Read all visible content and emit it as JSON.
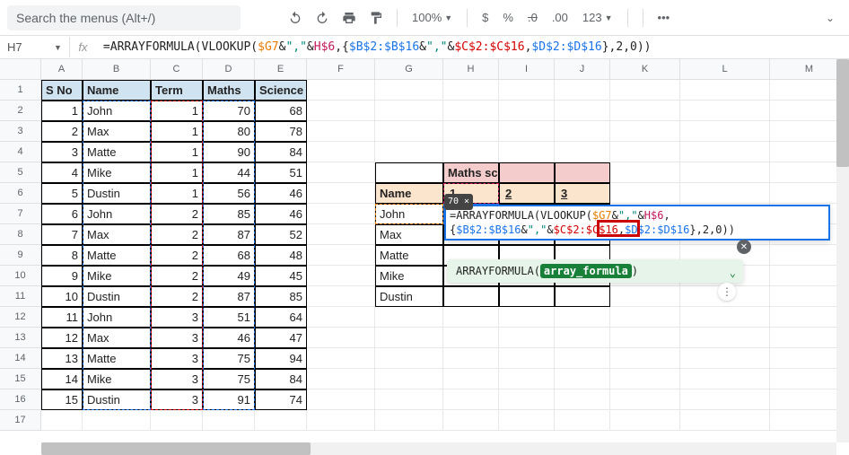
{
  "toolbar": {
    "search_placeholder": "Search the menus (Alt+/)",
    "zoom": "100%",
    "currency": "$",
    "percent": "%",
    "dec_dec": ".0",
    "inc_dec": ".00",
    "fmt": "123",
    "more": "•••"
  },
  "formulaBar": {
    "cellRef": "H7",
    "fx": "fx",
    "segments": [
      {
        "t": "=",
        "c": "eq"
      },
      {
        "t": "ARRAYFORMULA",
        "c": "fc-fn"
      },
      {
        "t": "(",
        "c": "fc-plain"
      },
      {
        "t": "VLOOKUP",
        "c": "fc-fn"
      },
      {
        "t": "(",
        "c": "fc-plain"
      },
      {
        "t": "$G7",
        "c": "fc-orange"
      },
      {
        "t": "&",
        "c": "fc-plain"
      },
      {
        "t": "\",\"",
        "c": "fc-teal"
      },
      {
        "t": "&",
        "c": "fc-plain"
      },
      {
        "t": "H$6",
        "c": "fc-mag"
      },
      {
        "t": ",{",
        "c": "fc-plain"
      },
      {
        "t": "$B$2:$B$16",
        "c": "fc-blue"
      },
      {
        "t": "&",
        "c": "fc-plain"
      },
      {
        "t": "\",\"",
        "c": "fc-teal"
      },
      {
        "t": "&",
        "c": "fc-plain"
      },
      {
        "t": "$C$2:$C$16",
        "c": "fc-red"
      },
      {
        "t": ",",
        "c": "fc-plain"
      },
      {
        "t": "$D$2:$D$16",
        "c": "fc-blue"
      },
      {
        "t": "},",
        "c": "fc-plain"
      },
      {
        "t": "2",
        "c": "fc-plain"
      },
      {
        "t": ",",
        "c": "fc-plain"
      },
      {
        "t": "0",
        "c": "fc-plain"
      },
      {
        "t": "))",
        "c": "fc-plain"
      }
    ]
  },
  "cols": [
    "A",
    "B",
    "C",
    "D",
    "E",
    "F",
    "G",
    "H",
    "I",
    "J",
    "K",
    "L",
    "M"
  ],
  "rows": [
    "1",
    "2",
    "3",
    "4",
    "5",
    "6",
    "7",
    "8",
    "9",
    "10",
    "11",
    "12",
    "13",
    "14",
    "15",
    "16",
    "17"
  ],
  "mainHeaders": {
    "a": "S No",
    "b": "Name",
    "c": "Term",
    "d": "Maths",
    "e": "Science"
  },
  "mainData": [
    {
      "sno": "1",
      "name": "John",
      "term": "1",
      "m": "70",
      "s": "68"
    },
    {
      "sno": "2",
      "name": "Max",
      "term": "1",
      "m": "80",
      "s": "78"
    },
    {
      "sno": "3",
      "name": "Matte",
      "term": "1",
      "m": "90",
      "s": "84"
    },
    {
      "sno": "4",
      "name": "Mike",
      "term": "1",
      "m": "44",
      "s": "51"
    },
    {
      "sno": "5",
      "name": "Dustin",
      "term": "1",
      "m": "56",
      "s": "46"
    },
    {
      "sno": "6",
      "name": "John",
      "term": "2",
      "m": "85",
      "s": "46"
    },
    {
      "sno": "7",
      "name": "Max",
      "term": "2",
      "m": "87",
      "s": "52"
    },
    {
      "sno": "8",
      "name": "Matte",
      "term": "2",
      "m": "68",
      "s": "48"
    },
    {
      "sno": "9",
      "name": "Mike",
      "term": "2",
      "m": "49",
      "s": "45"
    },
    {
      "sno": "10",
      "name": "Dustin",
      "term": "2",
      "m": "87",
      "s": "85"
    },
    {
      "sno": "11",
      "name": "John",
      "term": "3",
      "m": "51",
      "s": "64"
    },
    {
      "sno": "12",
      "name": "Max",
      "term": "3",
      "m": "46",
      "s": "47"
    },
    {
      "sno": "13",
      "name": "Matte",
      "term": "3",
      "m": "75",
      "s": "94"
    },
    {
      "sno": "14",
      "name": "Mike",
      "term": "3",
      "m": "75",
      "s": "84"
    },
    {
      "sno": "15",
      "name": "Dustin",
      "term": "3",
      "m": "91",
      "s": "74"
    }
  ],
  "side": {
    "title": "Maths scores",
    "nameHdr": "Name",
    "cols": [
      "1",
      "2",
      "3"
    ],
    "names": [
      "John",
      "Max",
      "Matte",
      "Mike",
      "Dustin"
    ]
  },
  "fedit": {
    "result": "70 ×",
    "line1a": "=ARRAYFORMULA(VLOOKUP(",
    "line1_g7": "$G7",
    "line1b": "&",
    "line1_q1": "\",\"",
    "line1c": "&",
    "line1_h6": "H$6",
    "line1d": ",{",
    "line1_b": "$B$2:$B$16",
    "line1e": "&",
    "line1_q2": "\",\"",
    "line1f": "&",
    "line1_c": "$C$2:$C$16",
    "line1g": ",",
    "line2_d": "$D$2:$D$16",
    "line2a": "},",
    "line2b": "2,0)",
    "line2c": ")"
  },
  "tooltip": {
    "fn": "ARRAYFORMULA(",
    "arg": "array_formula",
    "end": ")"
  }
}
